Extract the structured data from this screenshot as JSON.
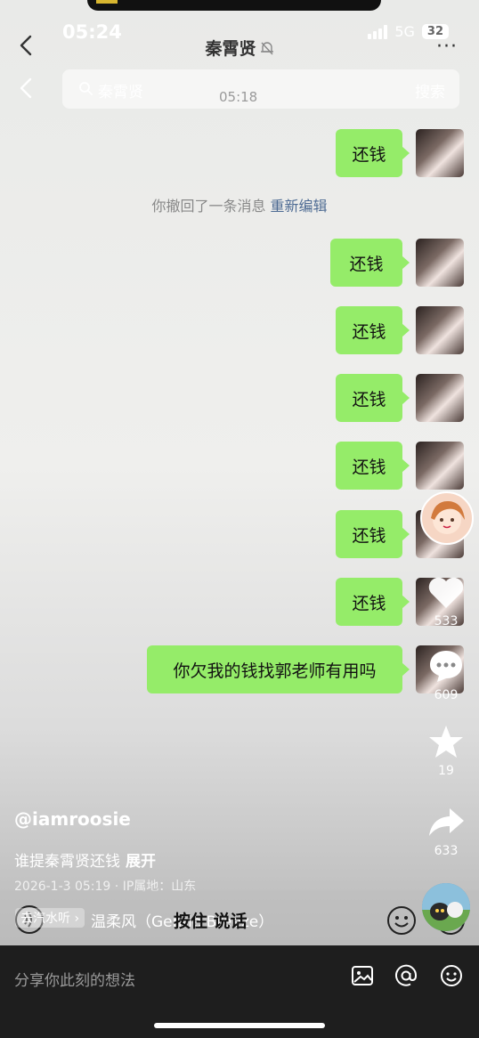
{
  "status": {
    "time": "05:24",
    "network": "5G",
    "battery": "32"
  },
  "chat": {
    "title": "秦霄贤",
    "more": "···"
  },
  "search": {
    "query": "秦霄贤",
    "timestamp": "05:18",
    "button": "搜索"
  },
  "messages": [
    {
      "text": "还钱"
    },
    {
      "text": "还钱"
    },
    {
      "text": "还钱"
    },
    {
      "text": "还钱"
    },
    {
      "text": "还钱"
    },
    {
      "text": "还钱"
    },
    {
      "text": "还钱"
    },
    {
      "text": "你欠我的钱找郭老师有用吗"
    }
  ],
  "recall": {
    "text": "你撤回了一条消息",
    "edit_label": "重新编辑"
  },
  "sidebar": {
    "like_count": "533",
    "comment_count": "609",
    "favorite_count": "19",
    "share_count": "633"
  },
  "post": {
    "author": "@iamroosie",
    "description": "谁提秦霄贤还钱",
    "expand_label": "展开",
    "meta": "2026-1-3 05:19 · IP属地：山东"
  },
  "input": {
    "music_tag": "去汽水听 ›",
    "music_title": "温柔风（Gentle Breeze）",
    "hold_to_talk": "按住 说话"
  },
  "comment": {
    "placeholder": "分享你此刻的想法"
  },
  "colors": {
    "bubble": "#95ec69",
    "link": "#4e6b93",
    "dark_bar": "#1e1e1e"
  }
}
